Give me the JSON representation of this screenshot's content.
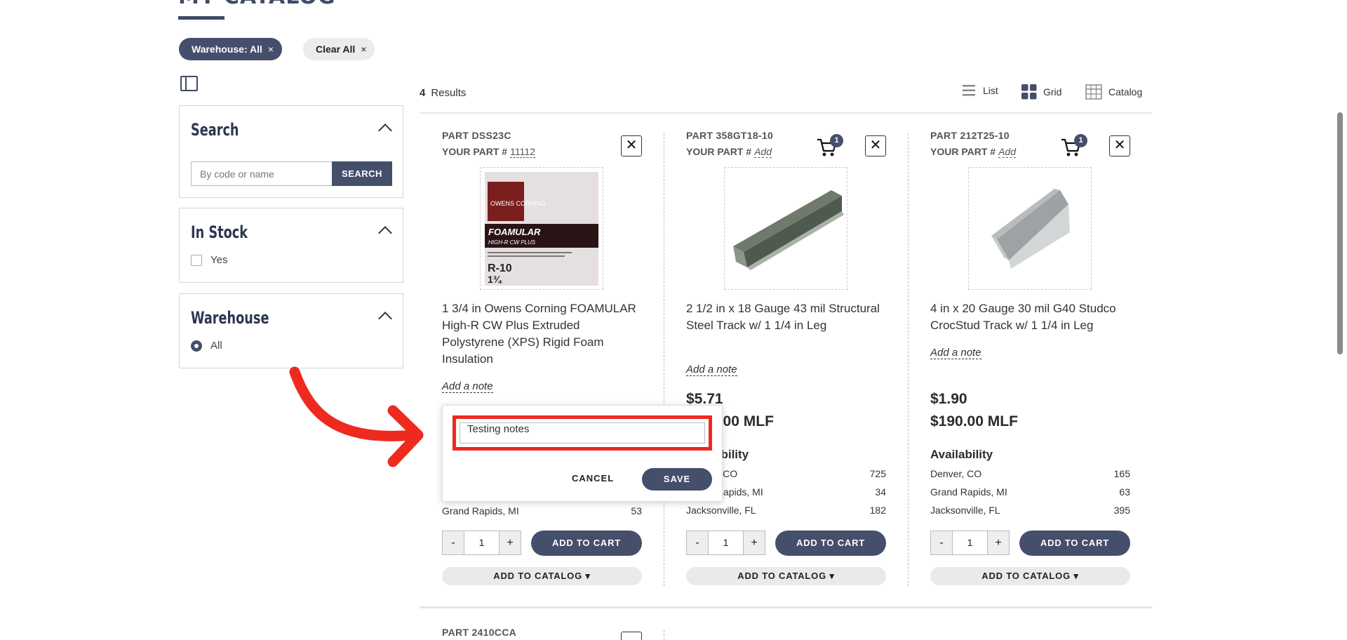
{
  "page": {
    "title": "MY CATALOG"
  },
  "filters": {
    "warehouse_chip": "Warehouse: All",
    "clear_chip": "Clear All",
    "remove_symbol": "×"
  },
  "sidebar": {
    "search": {
      "title": "Search",
      "placeholder": "By code or name",
      "button": "SEARCH"
    },
    "in_stock": {
      "title": "In Stock",
      "option": "Yes"
    },
    "warehouse": {
      "title": "Warehouse",
      "option": "All"
    }
  },
  "results": {
    "count": "4",
    "label": "Results",
    "views": [
      {
        "label": "List",
        "icon": "list-icon"
      },
      {
        "label": "Grid",
        "icon": "grid-icon"
      },
      {
        "label": "Catalog",
        "icon": "catalog-icon"
      }
    ]
  },
  "products": [
    {
      "part": "PART DSS23C",
      "your_part_label": "YOUR PART #",
      "your_part_value": "11112",
      "name": "1 3/4 in Owens Corning FOAMULAR High-R CW Plus Extruded Polystyrene (XPS) Rigid Foam Insulation",
      "add_note": "Add a note",
      "availability_visible": [
        {
          "loc": "Grand Rapids, MI",
          "qty": "53"
        }
      ],
      "qty": "1",
      "add_to_cart": "ADD TO CART",
      "add_to_catalog": "ADD TO CATALOG",
      "image_text": {
        "brand": "OWENS CORNING",
        "product": "FOAMULAR",
        "sub": "HIGH-R CW PLUS",
        "rvalue": "R-10",
        "thickness": "1¾"
      }
    },
    {
      "part": "PART 358GT18-10",
      "your_part_label": "YOUR PART #",
      "your_part_value": "Add",
      "cart_count": "1",
      "name": "2 1/2 in x 18 Gauge 43 mil Structural Steel Track w/ 1 1/4 in Leg",
      "add_note": "Add a note",
      "price": "$5.71",
      "price_mlf": "$571.00 MLF",
      "availability_label": "Availability",
      "availability": [
        {
          "loc": "Denver, CO",
          "qty": "725"
        },
        {
          "loc": "Grand Rapids, MI",
          "qty": "34"
        },
        {
          "loc": "Jacksonville, FL",
          "qty": "182"
        }
      ],
      "qty": "1",
      "add_to_cart": "ADD TO CART",
      "add_to_catalog": "ADD TO CATALOG"
    },
    {
      "part": "PART 212T25-10",
      "your_part_label": "YOUR PART #",
      "your_part_value": "Add",
      "cart_count": "1",
      "name": "4 in x 20 Gauge 30 mil G40 Studco CrocStud Track w/ 1 1/4 in Leg",
      "add_note": "Add a note",
      "price": "$1.90",
      "price_mlf": "$190.00 MLF",
      "availability_label": "Availability",
      "availability": [
        {
          "loc": "Denver, CO",
          "qty": "165"
        },
        {
          "loc": "Grand Rapids, MI",
          "qty": "63"
        },
        {
          "loc": "Jacksonville, FL",
          "qty": "395"
        }
      ],
      "qty": "1",
      "add_to_cart": "ADD TO CART",
      "add_to_catalog": "ADD TO CATALOG"
    },
    {
      "part": "PART 2410CCA"
    }
  ],
  "note_popover": {
    "value": "Testing notes",
    "cancel": "CANCEL",
    "save": "SAVE"
  },
  "colors": {
    "primary": "#454f6c",
    "highlight": "#ee2a1f"
  }
}
